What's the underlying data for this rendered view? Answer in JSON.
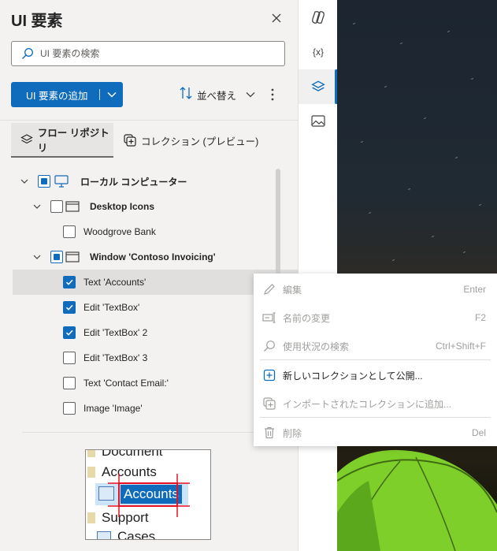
{
  "pane": {
    "title": "UI 要素",
    "search_placeholder": "UI 要素の検索",
    "add_button_label": "UI 要素の追加",
    "sort_label": "並べ替え",
    "tabs": [
      {
        "label": "フロー リポジトリ",
        "active": true
      },
      {
        "label": "コレクション (プレビュー)",
        "active": false
      }
    ]
  },
  "tree": {
    "rows": [
      {
        "label": "ローカル コンピューター",
        "bold": true,
        "check": "partial",
        "icon": "monitor-icon"
      },
      {
        "label": "Desktop Icons",
        "bold": true,
        "check": "unchecked",
        "icon": "window-icon"
      },
      {
        "label": "Woodgrove Bank",
        "bold": false,
        "check": "unchecked"
      },
      {
        "label": "Window 'Contoso Invoicing'",
        "bold": true,
        "check": "partial",
        "icon": "window-icon"
      },
      {
        "label": "Text 'Accounts'",
        "bold": false,
        "check": "checked",
        "selected": true
      },
      {
        "label": "Edit 'TextBox'",
        "bold": false,
        "check": "checked"
      },
      {
        "label": "Edit 'TextBox' 2",
        "bold": false,
        "check": "checked"
      },
      {
        "label": "Edit 'TextBox' 3",
        "bold": false,
        "check": "unchecked"
      },
      {
        "label": "Text 'Contact Email:'",
        "bold": false,
        "check": "unchecked"
      },
      {
        "label": "Image 'Image'",
        "bold": false,
        "check": "unchecked"
      }
    ]
  },
  "preview": {
    "lines": [
      "Document",
      "Accounts",
      "Accounts",
      "Support",
      "Cases"
    ]
  },
  "rail": {
    "variables_label": "{x}"
  },
  "menu": {
    "items": [
      {
        "label": "編集",
        "shortcut": "Enter",
        "enabled": false,
        "icon": "pencil-icon"
      },
      {
        "label": "名前の変更",
        "shortcut": "F2",
        "enabled": false,
        "icon": "rename-icon"
      },
      {
        "label": "使用状況の検索",
        "shortcut": "Ctrl+Shift+F",
        "enabled": false,
        "icon": "search-icon"
      },
      {
        "label": "新しいコレクションとして公開...",
        "shortcut": "",
        "enabled": true,
        "icon": "add-box-icon"
      },
      {
        "label": "インポートされたコレクションに追加...",
        "shortcut": "",
        "enabled": false,
        "icon": "collection-add-icon"
      },
      {
        "label": "削除",
        "shortcut": "Del",
        "enabled": false,
        "icon": "trash-icon"
      }
    ]
  },
  "colors": {
    "accent": "#0f6cbd",
    "pane_bg": "#f3f2f1",
    "selected_row": "#e1dfdd",
    "disabled_text": "#a19f9d"
  }
}
